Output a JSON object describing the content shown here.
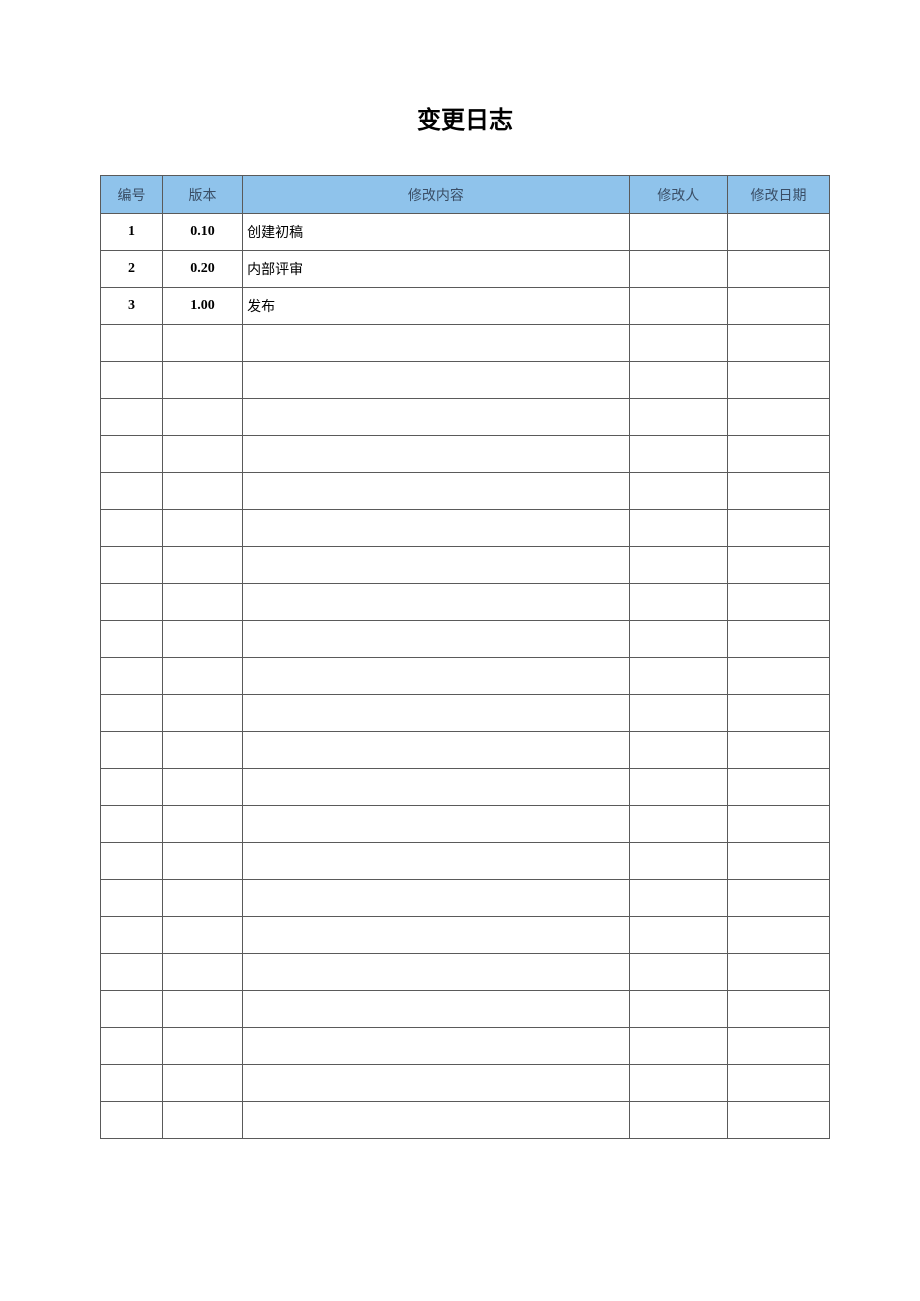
{
  "title": "变更日志",
  "columns": {
    "index": "编号",
    "version": "版本",
    "content": "修改内容",
    "author": "修改人",
    "date": "修改日期"
  },
  "rows": [
    {
      "index": "1",
      "version": "0.10",
      "content": "创建初稿",
      "author": "",
      "date": ""
    },
    {
      "index": "2",
      "version": "0.20",
      "content": "内部评审",
      "author": "",
      "date": ""
    },
    {
      "index": "3",
      "version": "1.00",
      "content": "发布",
      "author": "",
      "date": ""
    },
    {
      "index": "",
      "version": "",
      "content": "",
      "author": "",
      "date": ""
    },
    {
      "index": "",
      "version": "",
      "content": "",
      "author": "",
      "date": ""
    },
    {
      "index": "",
      "version": "",
      "content": "",
      "author": "",
      "date": ""
    },
    {
      "index": "",
      "version": "",
      "content": "",
      "author": "",
      "date": ""
    },
    {
      "index": "",
      "version": "",
      "content": "",
      "author": "",
      "date": ""
    },
    {
      "index": "",
      "version": "",
      "content": "",
      "author": "",
      "date": ""
    },
    {
      "index": "",
      "version": "",
      "content": "",
      "author": "",
      "date": ""
    },
    {
      "index": "",
      "version": "",
      "content": "",
      "author": "",
      "date": ""
    },
    {
      "index": "",
      "version": "",
      "content": "",
      "author": "",
      "date": ""
    },
    {
      "index": "",
      "version": "",
      "content": "",
      "author": "",
      "date": ""
    },
    {
      "index": "",
      "version": "",
      "content": "",
      "author": "",
      "date": ""
    },
    {
      "index": "",
      "version": "",
      "content": "",
      "author": "",
      "date": ""
    },
    {
      "index": "",
      "version": "",
      "content": "",
      "author": "",
      "date": ""
    },
    {
      "index": "",
      "version": "",
      "content": "",
      "author": "",
      "date": ""
    },
    {
      "index": "",
      "version": "",
      "content": "",
      "author": "",
      "date": ""
    },
    {
      "index": "",
      "version": "",
      "content": "",
      "author": "",
      "date": ""
    },
    {
      "index": "",
      "version": "",
      "content": "",
      "author": "",
      "date": ""
    },
    {
      "index": "",
      "version": "",
      "content": "",
      "author": "",
      "date": ""
    },
    {
      "index": "",
      "version": "",
      "content": "",
      "author": "",
      "date": ""
    },
    {
      "index": "",
      "version": "",
      "content": "",
      "author": "",
      "date": ""
    },
    {
      "index": "",
      "version": "",
      "content": "",
      "author": "",
      "date": ""
    },
    {
      "index": "",
      "version": "",
      "content": "",
      "author": "",
      "date": ""
    }
  ]
}
